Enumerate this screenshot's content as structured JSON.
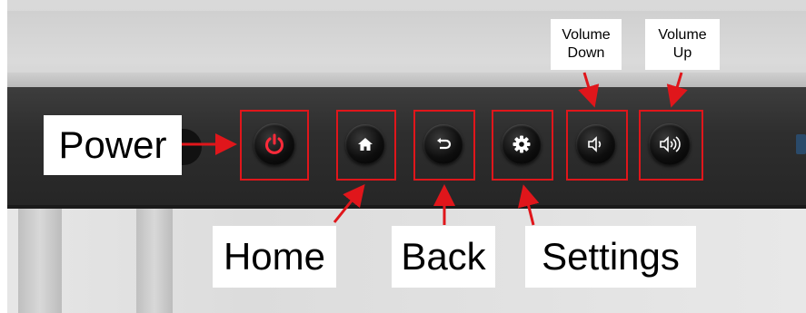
{
  "labels": {
    "power": "Power",
    "home": "Home",
    "back": "Back",
    "settings": "Settings",
    "volume_down_line1": "Volume",
    "volume_down_line2": "Down",
    "volume_up_line1": "Volume",
    "volume_up_line2": "Up"
  },
  "buttons": [
    {
      "name": "power",
      "icon": "power-icon"
    },
    {
      "name": "home",
      "icon": "home-icon"
    },
    {
      "name": "back",
      "icon": "back-arrow-icon"
    },
    {
      "name": "settings",
      "icon": "gear-icon"
    },
    {
      "name": "volume-down",
      "icon": "volume-down-icon"
    },
    {
      "name": "volume-up",
      "icon": "volume-up-icon"
    }
  ],
  "colors": {
    "highlight": "#e0161b",
    "power_icon": "#ff2a3a",
    "icon": "#ffffff",
    "bar": "#2e2e2e"
  }
}
